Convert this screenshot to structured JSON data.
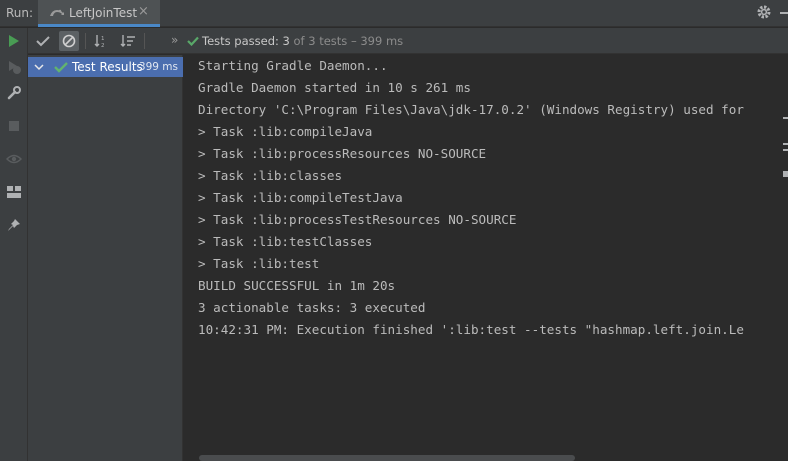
{
  "run_bar": {
    "label": "Run:",
    "tab_title": "LeftJoinTest",
    "close_glyph": "×",
    "icons": [
      "run-config-icon",
      "close-icon",
      "gear-icon",
      "minimize-icon"
    ]
  },
  "left_toolbar": {
    "icons": [
      "rerun-icon",
      "rerun-failed-icon",
      "wrench-icon",
      "stop-icon",
      "eye-icon",
      "layout-icon",
      "pin-icon"
    ]
  },
  "tree_toolbar": {
    "icons": [
      "show-passed-icon",
      "show-ignored-icon",
      "sort-alpha-icon",
      "sort-duration-icon"
    ],
    "expand_glyph": "»",
    "status_passed": "Tests passed: 3",
    "status_rest": " of 3 tests – 399 ms"
  },
  "tree": {
    "root": {
      "label": "Test Results",
      "duration": "399 ms",
      "status": "passed"
    }
  },
  "console": {
    "lines": [
      "Starting Gradle Daemon...",
      "Gradle Daemon started in 10 s 261 ms",
      "Directory 'C:\\Program Files\\Java\\jdk-17.0.2' (Windows Registry) used for",
      "> Task :lib:compileJava",
      "> Task :lib:processResources NO-SOURCE",
      "> Task :lib:classes",
      "> Task :lib:compileTestJava",
      "> Task :lib:processTestResources NO-SOURCE",
      "> Task :lib:testClasses",
      "> Task :lib:test",
      "BUILD SUCCESSFUL in 1m 20s",
      "3 actionable tasks: 3 executed",
      "10:42:31 PM: Execution finished ':lib:test --tests \"hashmap.left.join.Le"
    ],
    "horizontal_scroll_fraction": 0.64
  },
  "colors": {
    "pass_green": "#59a869",
    "run_green": "#499c54",
    "selection_blue": "#4b6eaf",
    "tab_underline": "#4a88c7"
  }
}
